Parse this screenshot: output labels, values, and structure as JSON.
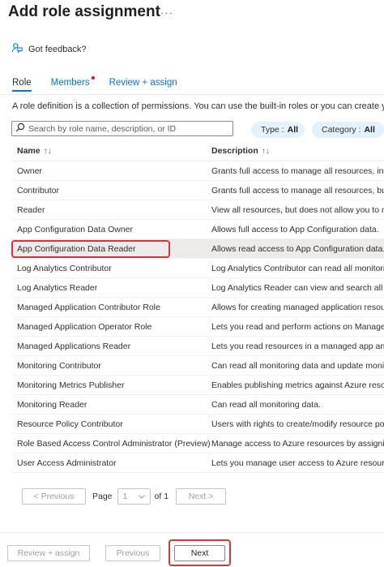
{
  "header": {
    "title": "Add role assignment",
    "more_label": "···",
    "feedback_label": "Got feedback?"
  },
  "tabs": [
    {
      "label": "Role",
      "active": true
    },
    {
      "label": "Members",
      "active": false,
      "required_dot": true
    },
    {
      "label": "Review + assign",
      "active": false
    }
  ],
  "description": "A role definition is a collection of permissions. You can use the built-in roles or you can create your own cu",
  "search": {
    "placeholder": "Search by role name, description, or ID",
    "value": ""
  },
  "filters": {
    "type": {
      "label": "Type :",
      "value": "All"
    },
    "category": {
      "label": "Category :",
      "value": "All"
    }
  },
  "table": {
    "columns": [
      {
        "label": "Name",
        "sort": "↑↓"
      },
      {
        "label": "Description",
        "sort": "↑↓"
      }
    ],
    "rows": [
      {
        "name": "Owner",
        "description": "Grants full access to manage all resources, includ"
      },
      {
        "name": "Contributor",
        "description": "Grants full access to manage all resources, but do"
      },
      {
        "name": "Reader",
        "description": "View all resources, but does not allow you to mak"
      },
      {
        "name": "App Configuration Data Owner",
        "description": "Allows full access to App Configuration data."
      },
      {
        "name": "App Configuration Data Reader",
        "description": "Allows read access to App Configuration data."
      },
      {
        "name": "Log Analytics Contributor",
        "description": "Log Analytics Contributor can read all monitoring"
      },
      {
        "name": "Log Analytics Reader",
        "description": "Log Analytics Reader can view and search all mon"
      },
      {
        "name": "Managed Application Contributor Role",
        "description": "Allows for creating managed application resource"
      },
      {
        "name": "Managed Application Operator Role",
        "description": "Lets you read and perform actions on Managed A"
      },
      {
        "name": "Managed Applications Reader",
        "description": "Lets you read resources in a managed app and re"
      },
      {
        "name": "Monitoring Contributor",
        "description": "Can read all monitoring data and update monitor"
      },
      {
        "name": "Monitoring Metrics Publisher",
        "description": "Enables publishing metrics against Azure resourc"
      },
      {
        "name": "Monitoring Reader",
        "description": "Can read all monitoring data."
      },
      {
        "name": "Resource Policy Contributor",
        "description": "Users with rights to create/modify resource policy"
      },
      {
        "name": "Role Based Access Control Administrator (Preview)",
        "description": "Manage access to Azure resources by assigning r"
      },
      {
        "name": "User Access Administrator",
        "description": "Lets you manage user access to Azure resources."
      }
    ],
    "selected_index": 4
  },
  "pagination": {
    "previous_label": "< Previous",
    "page_label": "Page",
    "current_page": "1",
    "of_label": "of 1",
    "next_label": "Next >"
  },
  "footer": {
    "review_assign_label": "Review + assign",
    "previous_label": "Previous",
    "next_label": "Next"
  },
  "colors": {
    "accent": "#0078d4",
    "highlight_box": "#e0313b",
    "pill_bg": "#e5f1fb",
    "selected_row": "#edebe9"
  }
}
